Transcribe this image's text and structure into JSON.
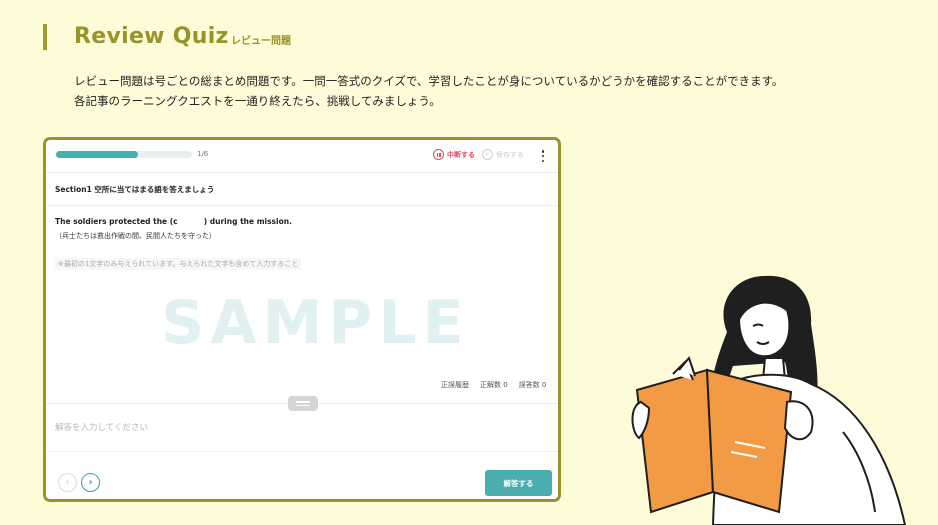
{
  "header": {
    "title": "Review Quiz",
    "subtitle": "レビュー問題"
  },
  "intro": {
    "line1": "レビュー問題は号ごとの総まとめ問題です。一問一答式のクイズで、学習したことが身についているかどうかを確認することができます。",
    "line2": "各記事のラーニングクエストを一通り終えたら、挑戦してみましょう。"
  },
  "quiz": {
    "progress_text": "1/6",
    "progress_fraction": 0.6,
    "pause_label": "中断する",
    "save_label": "保存する",
    "section_title": "Section1 空所に当てはまる語を答えましょう",
    "question": "The soldiers protected the (c          ) during the mission.",
    "translation": "（兵士たちは救出作戦の間、民間人たちを守った）",
    "hint": "※最初の1文字のみ与えられています。与えられた文字も含めて入力すること",
    "watermark": "SAMPLE",
    "stats": {
      "history_label": "正誤履歴",
      "correct_label": "正解数 0",
      "wrong_label": "誤答数 0"
    },
    "answer_placeholder": "解答を入力してください",
    "submit_label": "解答する",
    "prev_icon": "‹",
    "next_icon": "›"
  },
  "colors": {
    "background": "#fefcd8",
    "accent_olive": "#9a932a",
    "teal": "#4aaeb0",
    "pause_red": "#d94f62",
    "book_orange": "#f39a45"
  }
}
